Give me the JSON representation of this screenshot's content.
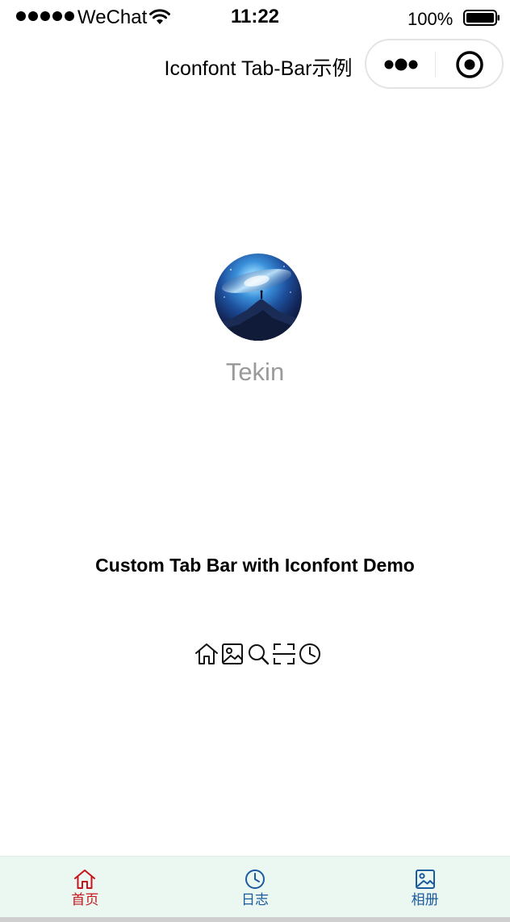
{
  "status_bar": {
    "carrier": "WeChat",
    "time": "11:22",
    "battery": "100%"
  },
  "nav": {
    "title": "Iconfont Tab-Bar示例",
    "menu_icon": "more-dots-icon",
    "close_icon": "close-miniprogram-icon"
  },
  "profile": {
    "name": "Tekin",
    "avatar": "galaxy-avatar"
  },
  "headline": "Custom Tab Bar with Iconfont Demo",
  "icon_row": [
    "home-icon",
    "image-icon",
    "search-icon",
    "scan-icon",
    "clock-icon"
  ],
  "tabbar": {
    "tabs": [
      {
        "label": "首页",
        "icon": "home-icon",
        "active": true
      },
      {
        "label": "日志",
        "icon": "clock-icon",
        "active": false
      },
      {
        "label": "相册",
        "icon": "image-icon",
        "active": false
      }
    ]
  },
  "colors": {
    "active_tab": "#c4161c",
    "inactive_tab": "#1a5a9e",
    "tabbar_bg": "#ebf7f1",
    "username": "#9a9a9a"
  }
}
